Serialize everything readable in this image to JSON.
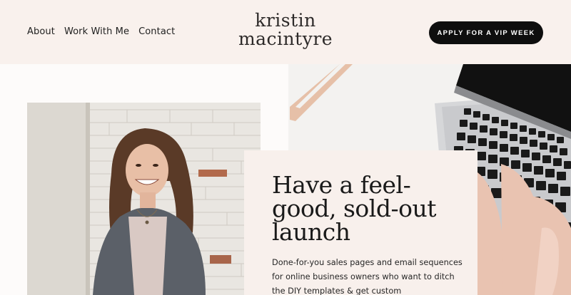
{
  "header": {
    "nav": [
      {
        "label": "About"
      },
      {
        "label": "Work With Me"
      },
      {
        "label": "Contact"
      }
    ],
    "logo": {
      "line1": "kristin",
      "line2": "macintyre"
    },
    "cta_label": "APPLY FOR A VIP WEEK"
  },
  "hero": {
    "headline": "Have a feel-good, sold-out launch",
    "body": "Done-for-you sales pages and email sequences for online business owners who want to ditch the DIY templates & get custom"
  },
  "colors": {
    "header_bg": "#f9f1ed",
    "card_bg": "#f8f0ec",
    "cta_bg": "#0e0e0e",
    "clipboard": "#e8c2ac",
    "laptop": "#141414"
  },
  "images": {
    "laptop_photo": "laptop-keyboard-with-hands",
    "portrait_photo": "smiling-woman-brick-wall"
  }
}
